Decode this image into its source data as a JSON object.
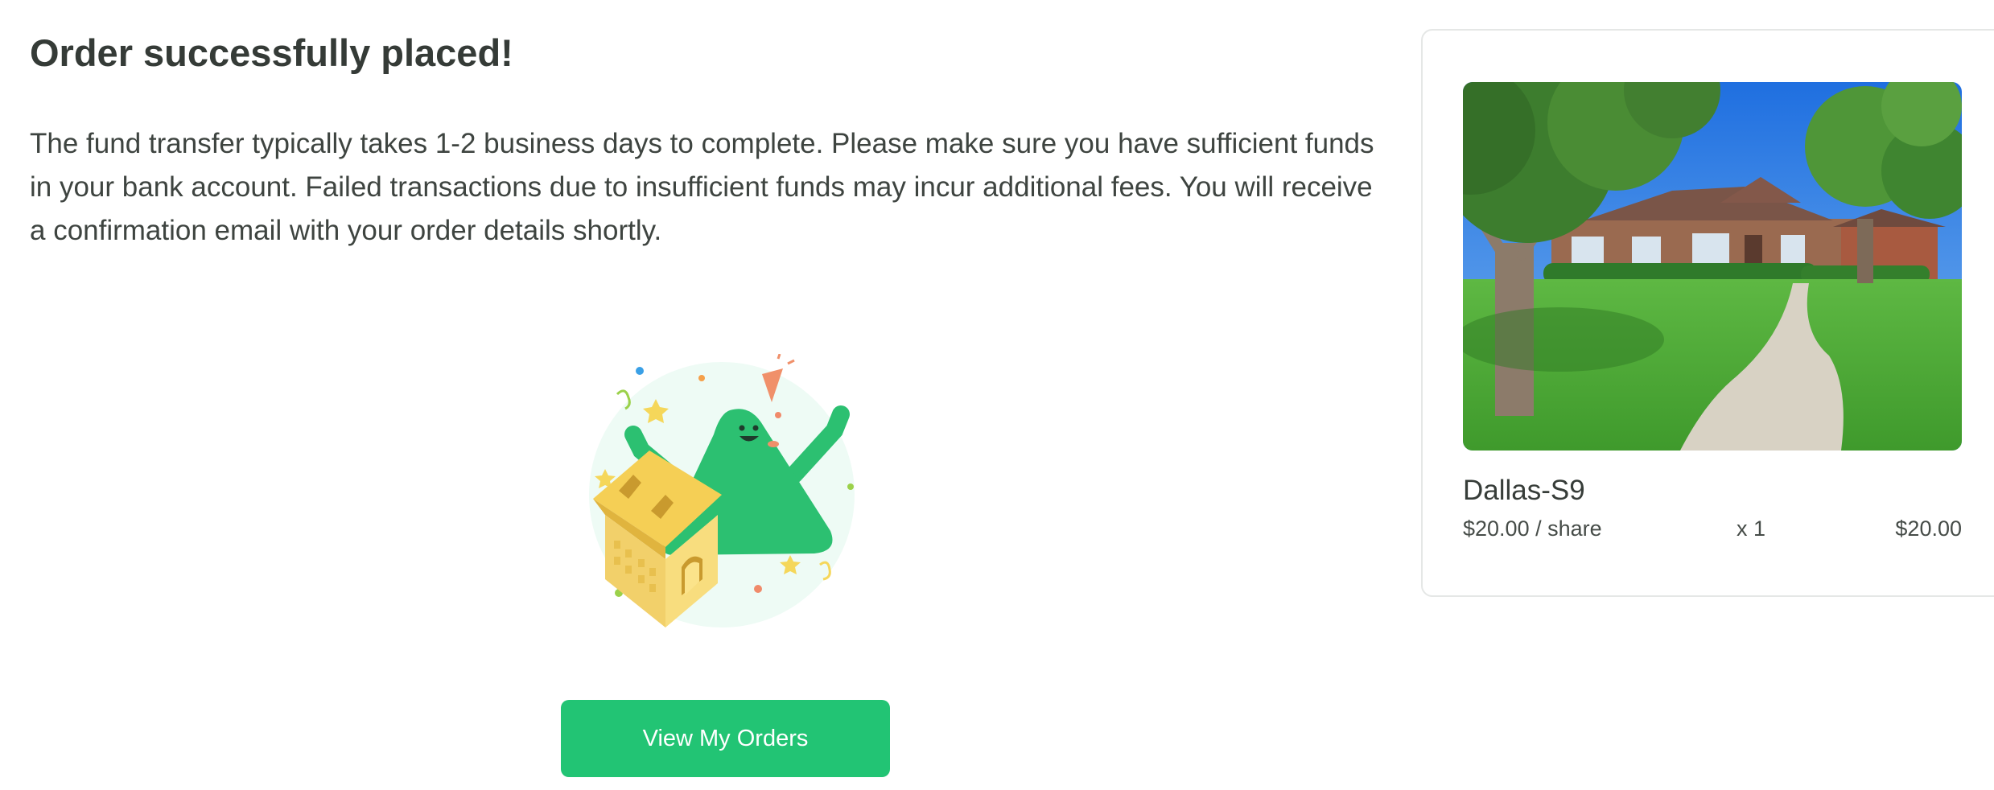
{
  "confirmation": {
    "title": "Order successfully placed!",
    "message": "The fund transfer typically takes 1-2 business days to complete. Please make sure you have sufficient funds in your bank account. Failed transactions due to insufficient funds may incur additional fees. You will receive a confirmation email with your order details shortly.",
    "cta_label": "View My Orders"
  },
  "order_item": {
    "name": "Dallas-S9",
    "price_per_share": "$20.00 / share",
    "quantity": "x 1",
    "total": "$20.00"
  },
  "colors": {
    "accent": "#22c474",
    "text": "#3a3f3c",
    "house_yellow": "#f5cf55",
    "mascot_green": "#2cc071"
  }
}
